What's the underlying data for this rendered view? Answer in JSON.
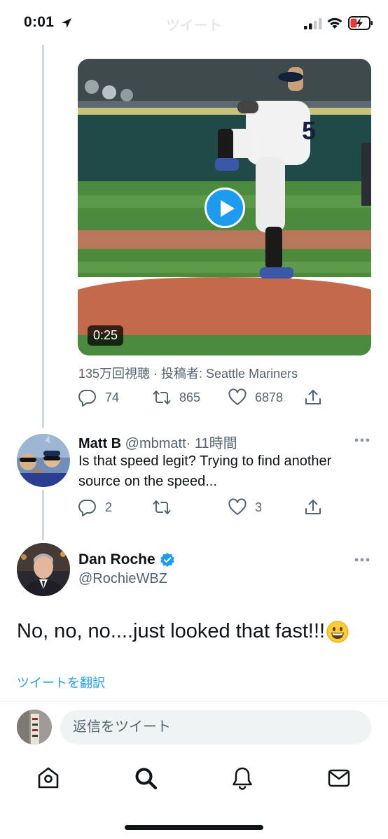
{
  "status_bar": {
    "time": "0:01",
    "title": "ツイート"
  },
  "video_tweet": {
    "duration": "0:25",
    "meta": "135万回視聴 · 投稿者: Seattle Mariners",
    "jersey_number": "5",
    "replies": "74",
    "retweets": "865",
    "likes": "6878"
  },
  "reply_tweet": {
    "name": "Matt B",
    "handle": "@mbmatt",
    "time": "· 11時間",
    "text": "Is that speed legit? Trying to find another source on the speed...",
    "replies": "2",
    "retweets": "",
    "likes": "3"
  },
  "main_tweet": {
    "name": "Dan Roche",
    "handle": "@RochieWBZ",
    "text": "No, no, no....just looked that fast!!!",
    "translate_label": "ツイートを翻訳"
  },
  "composer": {
    "placeholder": "返信をツイート"
  },
  "colors": {
    "accent": "#1d9bf0",
    "secondary_text": "#536471"
  },
  "icons": [
    "location-arrow-icon",
    "signal-icon",
    "wifi-icon",
    "battery-charging-icon",
    "play-icon",
    "reply-icon",
    "retweet-icon",
    "like-icon",
    "share-icon",
    "more-icon",
    "verified-badge-icon",
    "grinning-emoji-icon",
    "home-icon",
    "search-icon",
    "notifications-icon",
    "messages-icon"
  ]
}
